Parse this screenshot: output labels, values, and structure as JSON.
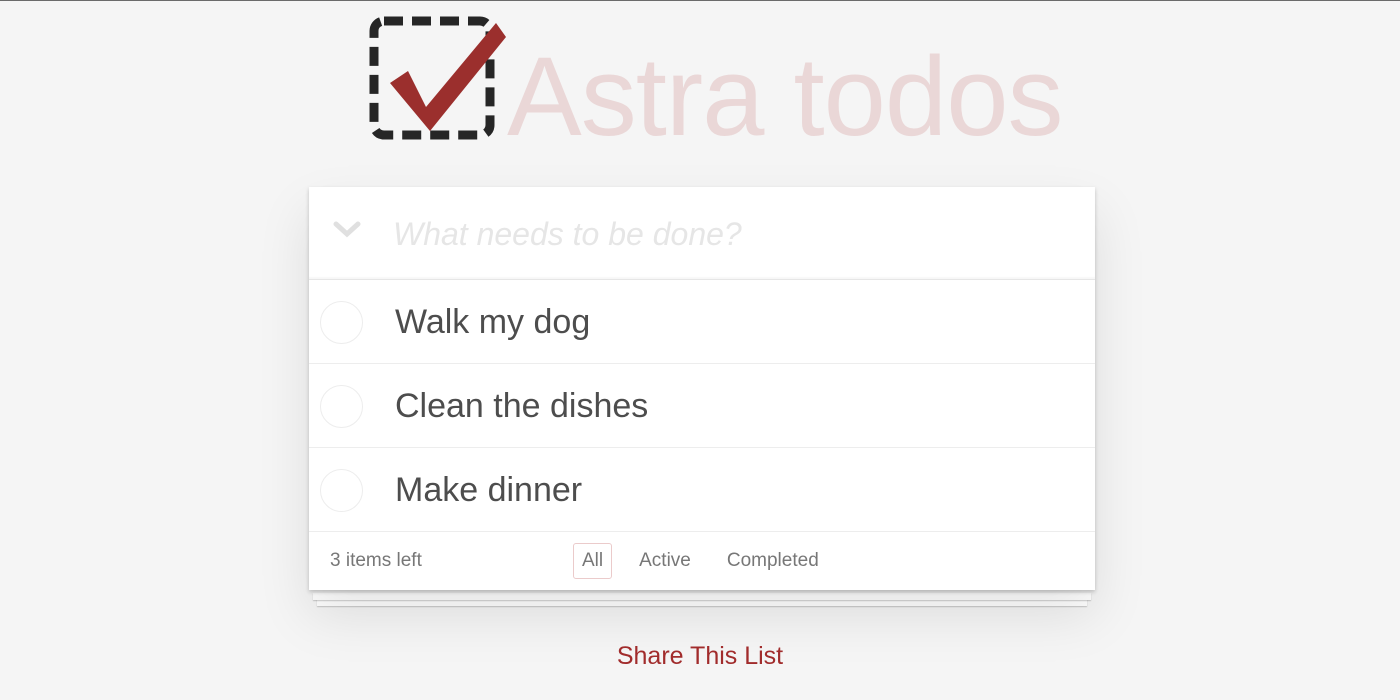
{
  "header": {
    "title": "Astra todos",
    "logo_icon": "checkbox-check-logo-icon",
    "logo_colors": {
      "box": "#262626",
      "check": "#9b2f2d"
    }
  },
  "new_todo": {
    "toggle_icon": "chevron-down-icon",
    "placeholder": "What needs to be done?",
    "value": ""
  },
  "todos": [
    {
      "label": "Walk my dog",
      "completed": false
    },
    {
      "label": "Clean the dishes",
      "completed": false
    },
    {
      "label": "Make dinner",
      "completed": false
    }
  ],
  "footer": {
    "count_text": "3 items left",
    "filters": [
      {
        "label": "All",
        "selected": true
      },
      {
        "label": "Active",
        "selected": false
      },
      {
        "label": "Completed",
        "selected": false
      }
    ]
  },
  "share": {
    "label": "Share This List"
  },
  "colors": {
    "background": "#f5f5f5",
    "title": "rgba(175,47,47,0.15)",
    "accent": "#a12c2c",
    "text": "#4d4d4d",
    "muted": "#777777"
  }
}
